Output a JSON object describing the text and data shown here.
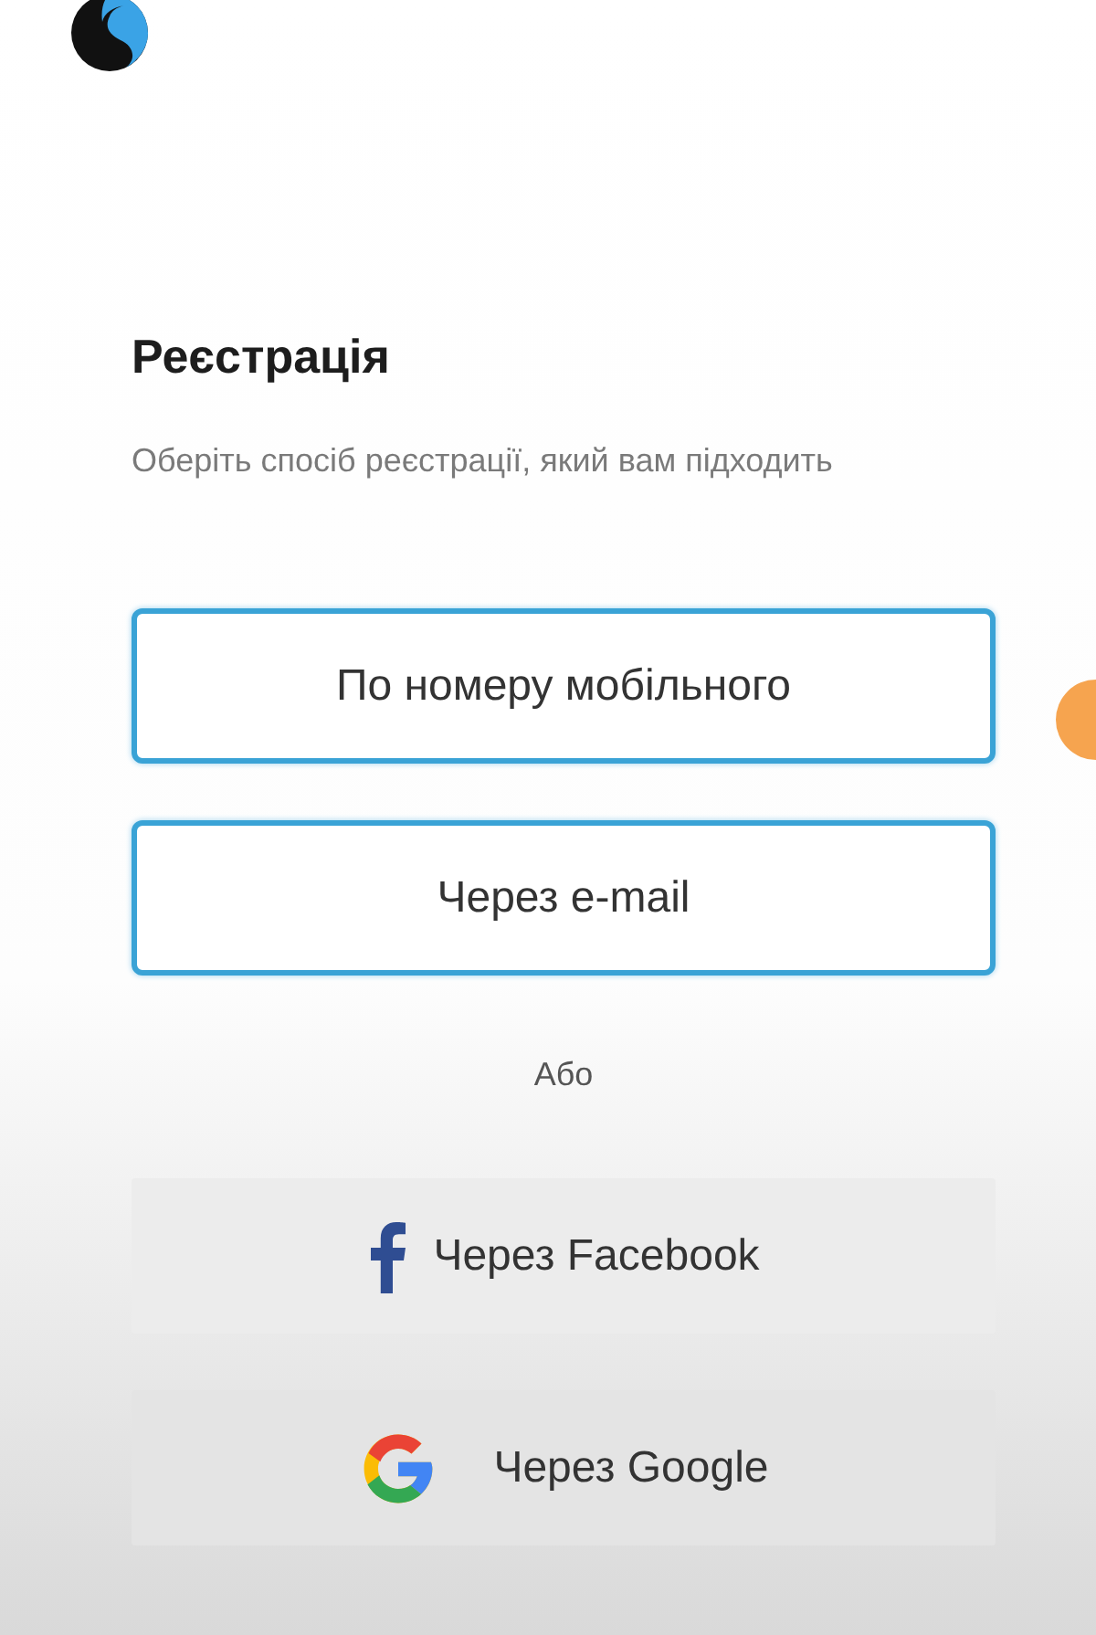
{
  "title": "Реєстрація",
  "subtitle": "Оберіть спосіб реєстрації, який вам підходить",
  "methods": [
    {
      "kind": "outline",
      "label": "По номеру мобільного"
    },
    {
      "kind": "outline",
      "label": "Через e-mail"
    }
  ],
  "separator": "Або",
  "social": [
    {
      "kind": "facebook",
      "label": "Через Facebook"
    },
    {
      "kind": "google",
      "label": "Через Google"
    }
  ]
}
